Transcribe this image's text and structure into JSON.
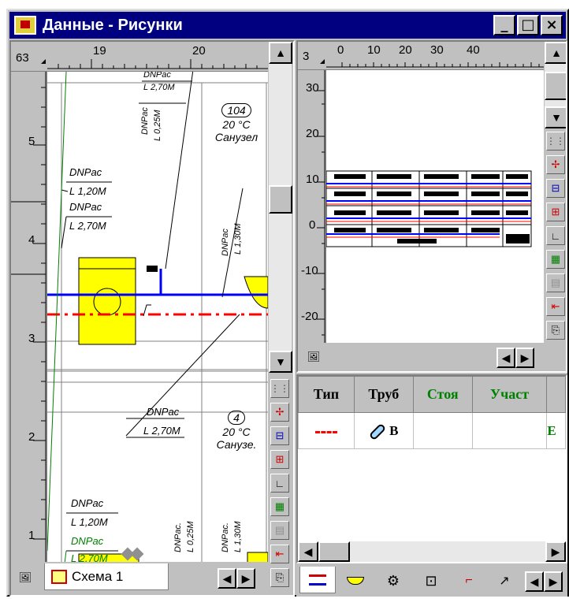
{
  "window": {
    "title": "Данные - Рисунки",
    "min_glyph": "_",
    "max_glyph": "□",
    "close_glyph": "×"
  },
  "left_pane": {
    "ruler_top": [
      "63",
      "19",
      "20"
    ],
    "ruler_left": [
      "5",
      "4",
      "3",
      "2",
      "1"
    ],
    "rooms": [
      {
        "number": "104",
        "temp": "20 °C",
        "name": "Санузел"
      },
      {
        "number": "4",
        "temp": "20 °C",
        "name": "Санузе."
      }
    ],
    "pipe_labels": [
      {
        "top": "DNPac",
        "bottom": "L 2,70M"
      },
      {
        "top": "DNPac",
        "bottom": "L 0,25M"
      },
      {
        "top": "DNPac",
        "bottom": "L 1,20M"
      },
      {
        "top": "DNPac",
        "bottom": "L 2,70M"
      },
      {
        "top": "DNPac",
        "bottom": "L 1,30M"
      },
      {
        "top": "DNPac",
        "bottom": "L 2,70M"
      },
      {
        "top": "DNPac",
        "bottom": "L 1,20M"
      },
      {
        "top": "DNPac",
        "bottom": "L 2,70M"
      },
      {
        "top": "DNPac.",
        "bottom": "L 0,25M"
      },
      {
        "top": "DNPac.",
        "bottom": "L 1,30M"
      }
    ],
    "tab_label": "Схема 1"
  },
  "right_pane": {
    "ruler_top": [
      "3",
      "0",
      "10",
      "20",
      "30",
      "40"
    ],
    "ruler_left": [
      "30",
      "20",
      "10",
      "0",
      "-10",
      "-20"
    ]
  },
  "grid": {
    "columns": [
      "Тип",
      "Труб",
      "Стоя",
      "Участ"
    ],
    "row": {
      "pipe_suffix": "B",
      "extra": "E"
    }
  },
  "colors": {
    "blue_pipe": "#0000ff",
    "red_pipe": "#ff0000",
    "fixture": "#ffff00",
    "green_header": "#008000"
  },
  "icons": [
    "app-icon",
    "minimize-icon",
    "maximize-icon",
    "close-icon",
    "scroll-up-icon",
    "scroll-down-icon",
    "scroll-left-icon",
    "scroll-right-icon",
    "grid-toggle-icon",
    "snap-icon",
    "frame-icon",
    "insert-icon",
    "angle-icon",
    "layer-icon",
    "disabled-icon",
    "arrow-back-icon",
    "export-icon",
    "preview-icon",
    "schema-tab-icon"
  ]
}
